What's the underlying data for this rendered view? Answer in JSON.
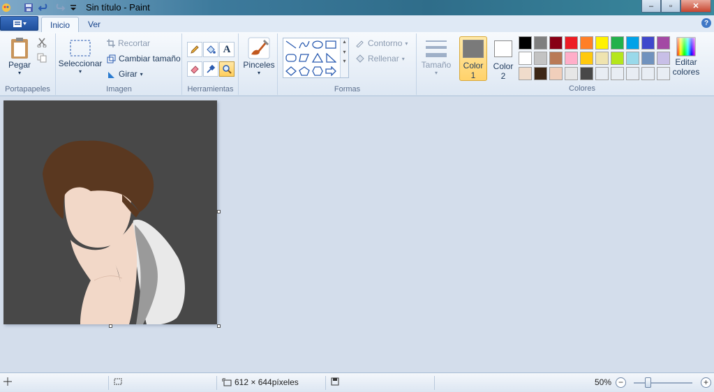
{
  "window": {
    "title": "Sin título - Paint",
    "minimize": "–",
    "maximize": "▫",
    "close": "✕"
  },
  "tabs": [
    {
      "label": "Inicio",
      "active": true
    },
    {
      "label": "Ver",
      "active": false
    }
  ],
  "ribbon": {
    "portapapeles": {
      "label": "Portapapeles",
      "paste": "Pegar"
    },
    "imagen": {
      "label": "Imagen",
      "select": "Seleccionar",
      "crop": "Recortar",
      "resize": "Cambiar tamaño",
      "rotate": "Girar"
    },
    "herramientas": {
      "label": "Herramientas"
    },
    "brushes": "Pinceles",
    "formas": {
      "label": "Formas",
      "outline": "Contorno",
      "fill": "Rellenar"
    },
    "size": "Tamaño",
    "color1": {
      "label": "Color",
      "num": "1",
      "value": "#7a7a7a"
    },
    "color2": {
      "label": "Color",
      "num": "2",
      "value": "#ffffff"
    },
    "colores": {
      "label": "Colores",
      "edit_line1": "Editar",
      "edit_line2": "colores",
      "palette": [
        "#000000",
        "#7f7f7f",
        "#880015",
        "#ed1c24",
        "#ff7f27",
        "#fff200",
        "#22b14c",
        "#00a2e8",
        "#3f48cc",
        "#a349a4",
        "#ffffff",
        "#c3c3c3",
        "#b97a57",
        "#ffaec9",
        "#ffc90e",
        "#efe4b0",
        "#b5e61d",
        "#99d9ea",
        "#7092be",
        "#c8bfe7",
        "#f0dccb",
        "#3d2716",
        "#f1cfbb",
        "#e6e6e6",
        "#484848",
        "#e8edf4",
        "#e8edf4",
        "#e8edf4",
        "#e8edf4",
        "#e8edf4"
      ]
    }
  },
  "status": {
    "dimensions": "612 × 644píxeles",
    "zoom": "50%"
  }
}
